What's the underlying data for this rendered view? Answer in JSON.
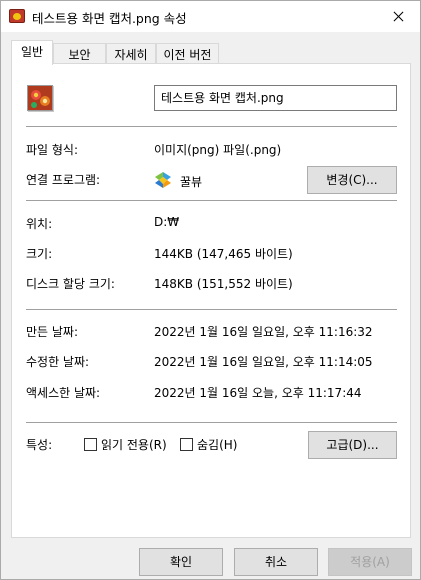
{
  "window": {
    "title": "테스트용 화면 캡처.png 속성"
  },
  "tabs": [
    {
      "label": "일반"
    },
    {
      "label": "보안"
    },
    {
      "label": "자세히"
    },
    {
      "label": "이전 버전"
    }
  ],
  "general": {
    "file_name": "테스트용 화면 캡처.png",
    "type_label": "파일 형식:",
    "type_value": "이미지(png) 파일(.png)",
    "opens_with_label": "연결 프로그램:",
    "opens_with_app": "꿀뷰",
    "change_button": "변경(C)...",
    "location_label": "위치:",
    "location_value": "D:₩",
    "size_label": "크기:",
    "size_value": "144KB (147,465 바이트)",
    "size_on_disk_label": "디스크 할당 크기:",
    "size_on_disk_value": "148KB (151,552 바이트)",
    "created_label": "만든 날짜:",
    "created_value": "2022년 1월 16일 일요일, 오후 11:16:32",
    "modified_label": "수정한 날짜:",
    "modified_value": "2022년 1월 16일 일요일, 오후 11:14:05",
    "accessed_label": "액세스한 날짜:",
    "accessed_value": "2022년 1월 16일 오늘, 오후 11:17:44",
    "attributes_label": "특성:",
    "readonly_label": "읽기 전용(R)",
    "readonly_checked": false,
    "hidden_label": "숨김(H)",
    "hidden_checked": false,
    "advanced_button": "고급(D)..."
  },
  "footer": {
    "ok": "확인",
    "cancel": "취소",
    "apply": "적용(A)"
  },
  "icons": {
    "title": "image-file-icon",
    "file": "image-file-icon",
    "program": "honeyview-icon",
    "close": "close-icon"
  }
}
